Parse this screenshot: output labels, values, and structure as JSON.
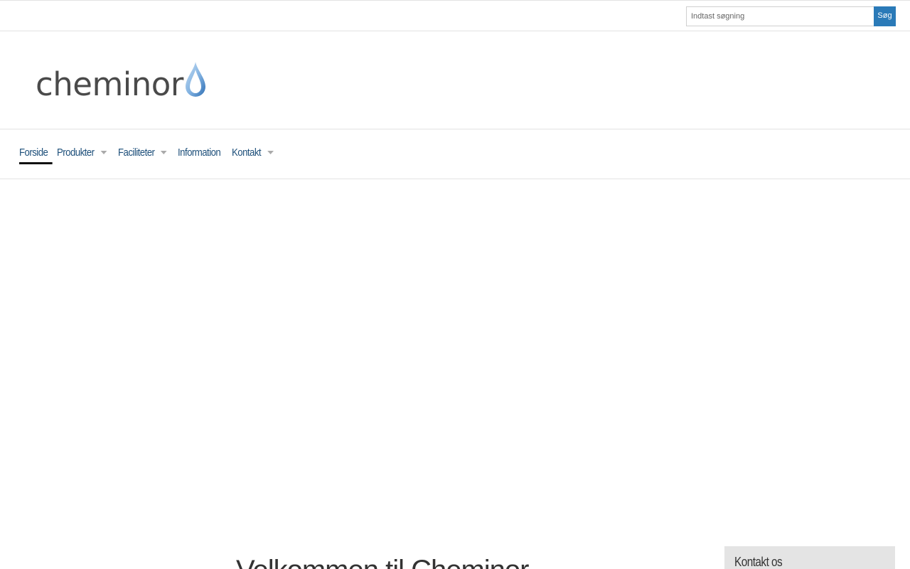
{
  "search": {
    "placeholder": "Indtast søgning",
    "button_label": "Søg"
  },
  "logo": {
    "text": "cheminor"
  },
  "nav": {
    "items": [
      {
        "label": "Forside",
        "active": true,
        "has_dropdown": false
      },
      {
        "label": "Produkter",
        "active": false,
        "has_dropdown": true
      },
      {
        "label": "Faciliteter",
        "active": false,
        "has_dropdown": true
      },
      {
        "label": "Information",
        "active": false,
        "has_dropdown": false
      },
      {
        "label": "Kontakt",
        "active": false,
        "has_dropdown": true
      }
    ]
  },
  "main": {
    "welcome_heading": "Velkommen til Cheminor"
  },
  "sidebar": {
    "contact_title": "Kontakt os"
  },
  "colors": {
    "accent": "#2a7ab8",
    "nav_text": "#1d4f7a",
    "drop_light": "#a9cdee",
    "drop_dark": "#3a7fc3"
  },
  "icons": {
    "logo_mark": "water-drop-icon",
    "dropdown": "caret-down-icon"
  }
}
